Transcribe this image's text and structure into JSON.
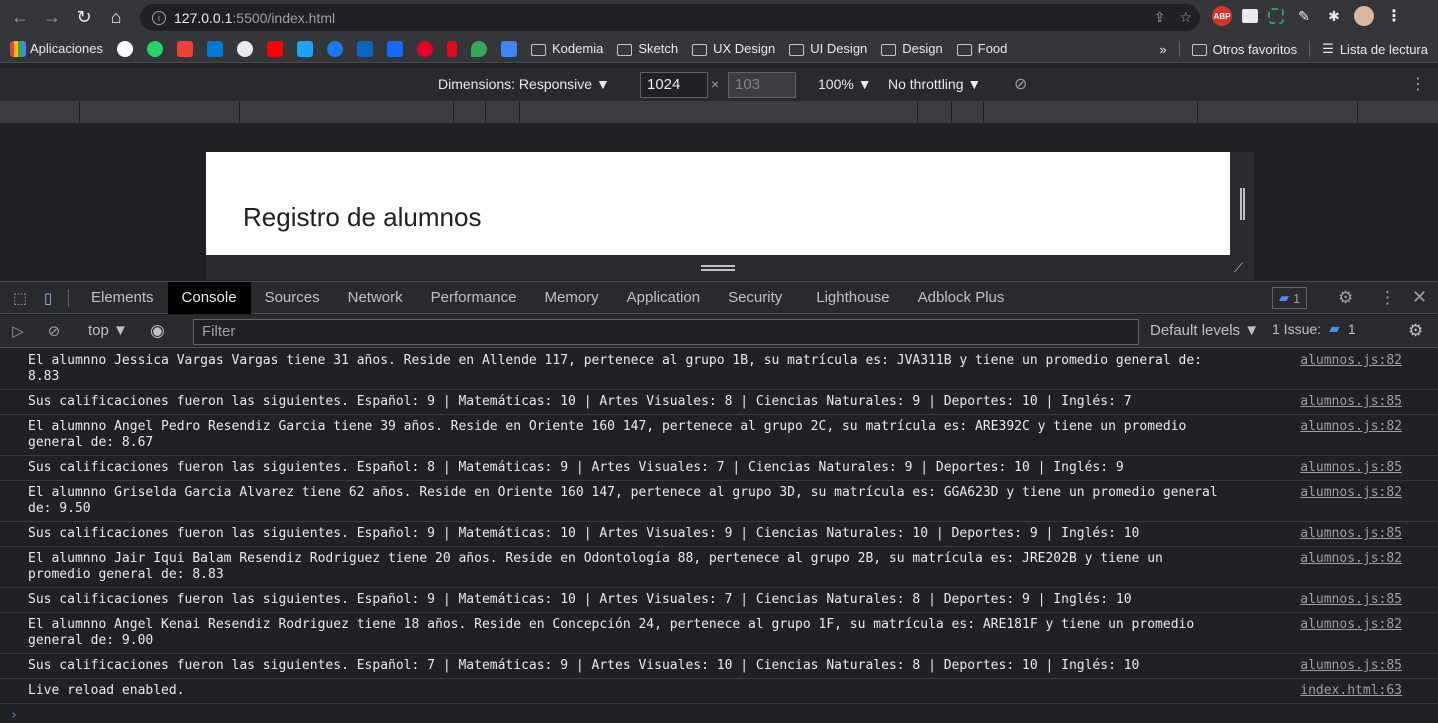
{
  "browser": {
    "url_host": "127.0.0.1",
    "url_rest": ":5500/index.html",
    "bookmarks": [
      "Aplicaciones",
      "Kodemia",
      "Sketch",
      "UX Design",
      "UI Design",
      "Design",
      "Food"
    ],
    "bookmarks_overflow": "»",
    "other_bookmarks": "Otros favoritos",
    "reading_list": "Lista de lectura",
    "ext_abp": "ABP"
  },
  "device_toolbar": {
    "dimensions_label": "Dimensions: Responsive ▼",
    "width_value": "1024",
    "height_value": "103",
    "times": "×",
    "zoom": "100% ▼",
    "throttling": "No throttling ▼"
  },
  "page": {
    "heading": "Registro de alumnos"
  },
  "devtools": {
    "tabs": [
      "Elements",
      "Console",
      "Sources",
      "Network",
      "Performance",
      "Memory",
      "Application",
      "Security",
      "Lighthouse",
      "Adblock Plus"
    ],
    "active_tab": "Console",
    "message_badge": "1",
    "context": "top",
    "filter_placeholder": "Filter",
    "default_levels": "Default levels ▼",
    "issues": "1 Issue:",
    "issues_count": "1"
  },
  "console": {
    "logs": [
      {
        "msg": "El alumnno Jessica Vargas Vargas tiene 31 años. Reside en Allende 117, pertenece al grupo 1B, su matrícula es: JVA311B y tiene un promedio general de:\n8.83",
        "src": "alumnos.js:82"
      },
      {
        "msg": "Sus calificaciones fueron las siguientes. Español: 9 | Matemáticas: 10 | Artes Visuales: 8 | Ciencias Naturales: 9 | Deportes: 10 | Inglés: 7",
        "src": "alumnos.js:85"
      },
      {
        "msg": "El alumnno Angel Pedro Resendiz Garcia tiene 39 años. Reside en Oriente 160 147, pertenece al grupo 2C, su matrícula es: ARE392C y tiene un promedio\ngeneral de: 8.67",
        "src": "alumnos.js:82"
      },
      {
        "msg": "Sus calificaciones fueron las siguientes. Español: 8 | Matemáticas: 9 | Artes Visuales: 7 | Ciencias Naturales: 9 | Deportes: 10 | Inglés: 9",
        "src": "alumnos.js:85"
      },
      {
        "msg": "El alumnno Griselda Garcia Alvarez tiene 62 años. Reside en Oriente 160 147, pertenece al grupo 3D, su matrícula es: GGA623D y tiene un promedio general\nde: 9.50",
        "src": "alumnos.js:82"
      },
      {
        "msg": "Sus calificaciones fueron las siguientes. Español: 9 | Matemáticas: 10 | Artes Visuales: 9 | Ciencias Naturales: 10 | Deportes: 9 | Inglés: 10",
        "src": "alumnos.js:85"
      },
      {
        "msg": "El alumnno Jair Iqui Balam Resendiz Rodriguez tiene 20 años. Reside en Odontología 88, pertenece al grupo 2B, su matrícula es: JRE202B y tiene un\npromedio general de: 8.83",
        "src": "alumnos.js:82"
      },
      {
        "msg": "Sus calificaciones fueron las siguientes. Español: 9 | Matemáticas: 10 | Artes Visuales: 7 | Ciencias Naturales: 8 | Deportes: 9 | Inglés: 10",
        "src": "alumnos.js:85"
      },
      {
        "msg": "El alumnno Angel Kenai Resendiz Rodriguez tiene 18 años. Reside en Concepción 24, pertenece al grupo 1F, su matrícula es: ARE181F y tiene un promedio\ngeneral de: 9.00",
        "src": "alumnos.js:82"
      },
      {
        "msg": "Sus calificaciones fueron las siguientes. Español: 7 | Matemáticas: 9 | Artes Visuales: 10 | Ciencias Naturales: 8 | Deportes: 10 | Inglés: 10",
        "src": "alumnos.js:85"
      },
      {
        "msg": "Live reload enabled.",
        "src": "index.html:63"
      }
    ],
    "prompt": "›"
  }
}
